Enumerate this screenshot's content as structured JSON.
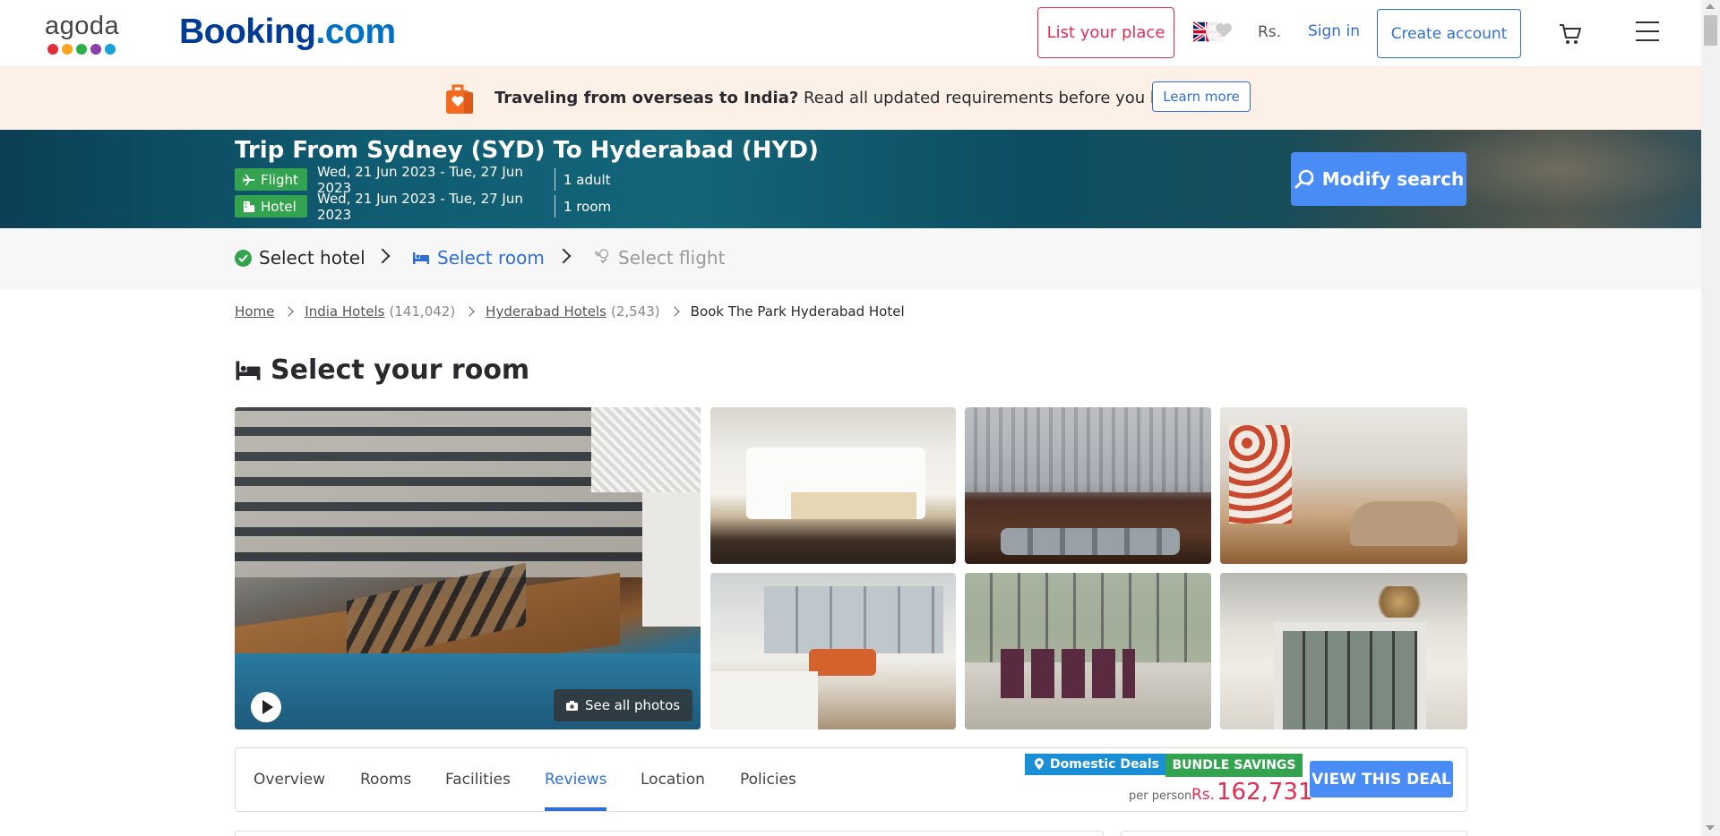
{
  "header": {
    "agoda_logo": "agoda",
    "agoda_dot_colors": [
      "#e12d3c",
      "#f8a41c",
      "#2bb04a",
      "#8b3fa8",
      "#17a2d8"
    ],
    "booking_logo_1": "Booking",
    "booking_logo_2": ".com",
    "list_place": "List your place",
    "currency": "Rs.",
    "sign_in": "Sign in",
    "create_account": "Create account"
  },
  "notice": {
    "bold": "Traveling from overseas to India?",
    "rest": " Read all updated requirements before you book.",
    "learn_more": "Learn more"
  },
  "trip": {
    "title": "Trip From Sydney (SYD) To Hyderabad (HYD)",
    "flight_label": "Flight",
    "flight_dates": "Wed, 21 Jun 2023 - Tue, 27 Jun 2023",
    "flight_pax": "1 adult",
    "hotel_label": "Hotel",
    "hotel_dates": "Wed, 21 Jun 2023 - Tue, 27 Jun 2023",
    "hotel_rooms": "1 room",
    "modify": "Modify search"
  },
  "steps": {
    "step1": "Select hotel",
    "step2": "Select room",
    "step3": "Select flight"
  },
  "breadcrumb": {
    "home": "Home",
    "india": "India Hotels",
    "india_count": "(141,042)",
    "hyderabad": "Hyderabad Hotels",
    "hyderabad_count": "(2,543)",
    "current": "Book The Park Hyderabad Hotel"
  },
  "room": {
    "heading": "Select your room",
    "see_all_photos": "See all photos"
  },
  "tabs": [
    "Overview",
    "Rooms",
    "Facilities",
    "Reviews",
    "Location",
    "Policies"
  ],
  "active_tab": "Reviews",
  "deal": {
    "domestic": "Domestic Deals",
    "bundle": "BUNDLE SAVINGS",
    "per_person": "per person",
    "currency": "Rs.",
    "price": "162,731",
    "cta": "VIEW THIS DEAL"
  },
  "colors": {
    "accent": "#2f6ed8",
    "price": "#e12d54",
    "success": "#33a34f"
  }
}
